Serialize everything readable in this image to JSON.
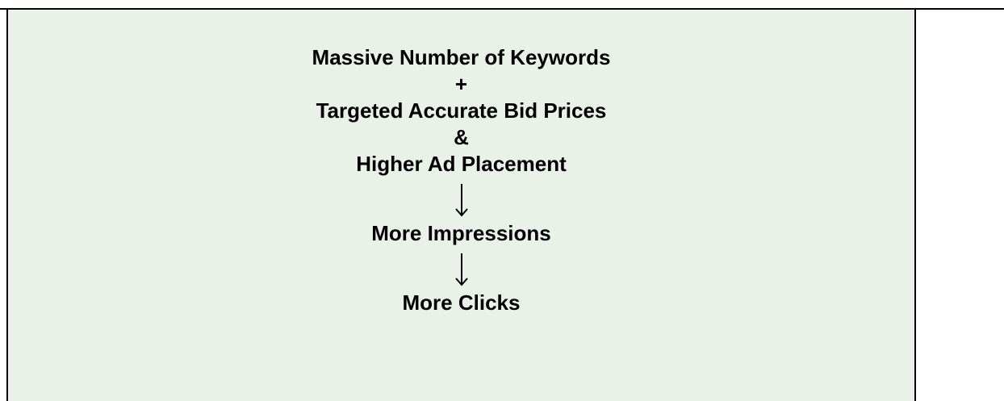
{
  "flow": {
    "line1": "Massive Number of Keywords",
    "op1": "+",
    "line2": "Targeted Accurate Bid Prices",
    "op2": "&",
    "line3": "Higher Ad Placement",
    "line4": "More Impressions",
    "line5": "More Clicks"
  },
  "colors": {
    "cell_background": "#e9f1e9",
    "border": "#000000",
    "text": "#000000"
  },
  "icons": [
    "down-arrow-icon",
    "down-arrow-icon"
  ]
}
